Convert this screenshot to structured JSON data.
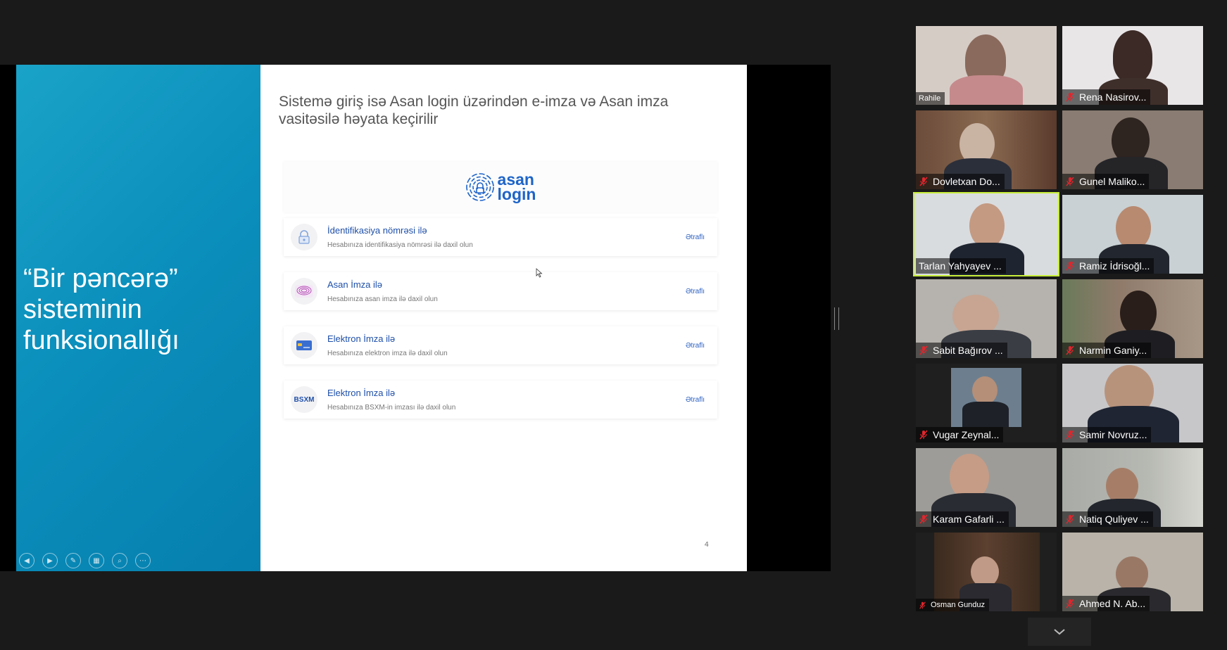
{
  "slide": {
    "left_title": "“Bir pəncərə” sisteminin funksionallığı",
    "heading": "Sistemə giriş isə Asan login üzərindən e-imza və Asan imza vasitəsilə həyata keçirilir",
    "logo_top": "asan",
    "logo_bottom": "login",
    "page_number": "4",
    "rows": [
      {
        "title": "İdentifikasiya nömrəsi ilə",
        "subtitle": "Hesabınıza identifikasiya nömrəsi ilə daxil olun",
        "more": "Ətraflı",
        "icon": "lock-icon"
      },
      {
        "title": "Asan İmza ilə",
        "subtitle": "Hesabınıza asan imza ilə daxil olun",
        "more": "Ətraflı",
        "icon": "asan-imza-icon"
      },
      {
        "title": "Elektron İmza ilə",
        "subtitle": "Hesabınıza elektron imza ilə daxil olun",
        "more": "Ətraflı",
        "icon": "card-icon"
      },
      {
        "title": "Elektron İmza ilə",
        "subtitle": "Hesabınıza BSXM-in imzası ilə daxil olun",
        "more": "Ətraflı",
        "icon": "bsxm-icon",
        "icon_text": "BSXM"
      }
    ]
  },
  "participants": [
    {
      "name": "Rahile",
      "muted": false,
      "active": false,
      "bg": "#d6ccc6"
    },
    {
      "name": "Rena Nasirov...",
      "muted": true,
      "active": false,
      "bg": "#e9e6e8"
    },
    {
      "name": "Dovletxan Do...",
      "muted": true,
      "active": false,
      "bg": "#6b4b3a"
    },
    {
      "name": "Gunel Maliko...",
      "muted": true,
      "active": false,
      "bg": "#8a7c72"
    },
    {
      "name": "Tarlan Yahyayev ...",
      "muted": false,
      "active": true,
      "bg": "#d9dcdf"
    },
    {
      "name": "Ramiz İdrisoğl...",
      "muted": true,
      "active": false,
      "bg": "#c9d1d4"
    },
    {
      "name": "Sabit Bağırov ...",
      "muted": true,
      "active": false,
      "bg": "#b6b2ad"
    },
    {
      "name": "Narmin Ganiy...",
      "muted": true,
      "active": false,
      "bg": "#8f7a6a"
    },
    {
      "name": "Vugar Zeynal...",
      "muted": true,
      "active": false,
      "bg": "#1f1f1f"
    },
    {
      "name": "Samir Novruz...",
      "muted": true,
      "active": false,
      "bg": "#c7c7c9"
    },
    {
      "name": "Karam Gafarli ...",
      "muted": true,
      "active": false,
      "bg": "#9e9c98"
    },
    {
      "name": "Natiq Quliyev ...",
      "muted": true,
      "active": false,
      "bg": "#a8aba6"
    },
    {
      "name": "Osman Gunduz",
      "muted": true,
      "active": false,
      "bg": "#1f1f1f"
    },
    {
      "name": "Ahmed N. Ab...",
      "muted": true,
      "active": false,
      "bg": "#b9b3a9"
    }
  ],
  "controls": [
    "prev-icon",
    "next-icon",
    "pen-icon",
    "grid-icon",
    "zoom-icon",
    "more-icon"
  ],
  "colors": {
    "mute_red": "#e0262d",
    "active_border": "#c8ee3a",
    "slide_blue": "#0b8fbc"
  }
}
